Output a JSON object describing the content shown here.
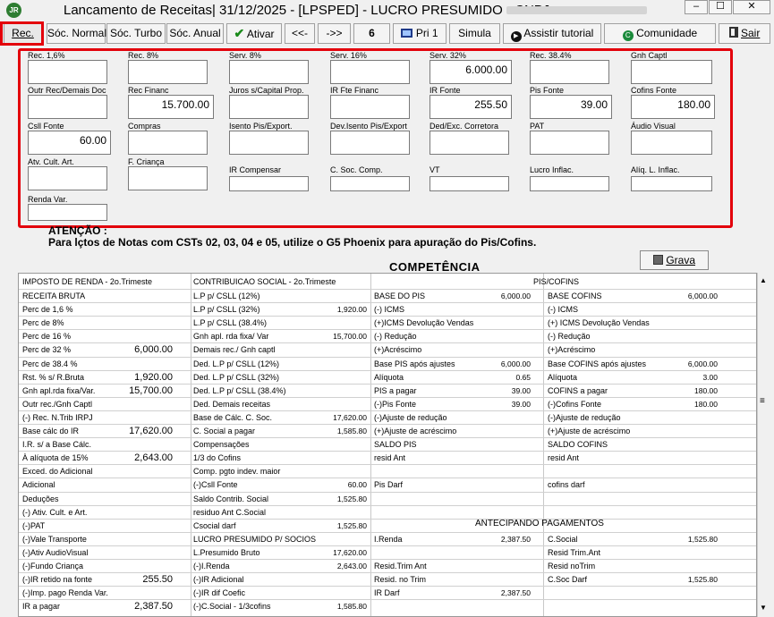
{
  "window": {
    "title": "Lancamento de Receitas|  31/12/2025 - [LPSPED] - LUCRO PRESUMIDO - CNPJ:",
    "min": "–",
    "max": "☐",
    "close": "✕"
  },
  "toolbar": {
    "rec": "Rec.",
    "socio_normal": "Sóc. Normal",
    "socio_turbo": "Sóc. Turbo",
    "socio_anual": "Sóc. Anual",
    "ativar": "Ativar",
    "prev": "<<-",
    "next": "->>",
    "page": "6",
    "pri": "Pri 1",
    "simula": "Simula",
    "tutorial": "Assistir tutorial",
    "comunidade": "Comunidade",
    "sair": "Sair"
  },
  "fields": {
    "rec16": {
      "label": "Rec. 1,6%",
      "value": ""
    },
    "rec8": {
      "label": "Rec. 8%",
      "value": ""
    },
    "serv8": {
      "label": "Serv. 8%",
      "value": ""
    },
    "serv16": {
      "label": "Serv. 16%",
      "value": ""
    },
    "serv32": {
      "label": "Serv. 32%",
      "value": "6.000.00"
    },
    "rec384": {
      "label": "Rec. 38.4%",
      "value": ""
    },
    "gnh_captl": {
      "label": "Gnh Captl",
      "value": ""
    },
    "outr_rec": {
      "label": "Outr Rec/Demais Doc",
      "value": ""
    },
    "rec_financ": {
      "label": "Rec Financ",
      "value": "15.700.00"
    },
    "juros_capital": {
      "label": "Juros s/Capital Prop.",
      "value": ""
    },
    "ir_fte_financ": {
      "label": "IR Fte Financ",
      "value": ""
    },
    "ir_fonte": {
      "label": "IR Fonte",
      "value": "255.50"
    },
    "pis_fonte": {
      "label": "Pis Fonte",
      "value": "39.00"
    },
    "cofins_fonte": {
      "label": "Cofins Fonte",
      "value": "180.00"
    },
    "csll_fonte": {
      "label": "Csll Fonte",
      "value": "60.00"
    },
    "compras": {
      "label": "Compras",
      "value": ""
    },
    "isento_pis": {
      "label": "Isento Pis/Export.",
      "value": ""
    },
    "dev_isento_pis": {
      "label": "Dev.Isento Pis/Export",
      "value": ""
    },
    "ded_exc": {
      "label": "Ded/Exc. Corretora",
      "value": ""
    },
    "pat": {
      "label": "PAT",
      "value": ""
    },
    "audio_visual": {
      "label": "Áudio Visual",
      "value": ""
    },
    "atv_cult": {
      "label": "Atv. Cult. Art.",
      "value": ""
    },
    "f_crianca": {
      "label": "F. Criança",
      "value": ""
    },
    "ir_compensar": {
      "label": "IR Compensar",
      "value": ""
    },
    "c_soc_comp": {
      "label": "C. Soc. Comp.",
      "value": ""
    },
    "vt": {
      "label": "VT",
      "value": ""
    },
    "lucro_inflac": {
      "label": "Lucro Inflac.",
      "value": ""
    },
    "aliq_l_inflac": {
      "label": "Alíq. L. Inflac.",
      "value": ""
    },
    "renda_var": {
      "label": "Renda Var.",
      "value": ""
    }
  },
  "atencao": "ATENÇÃO :",
  "message": "Para lçtos de Notas com CSTs 02, 03, 04 e 05, utilize o G5 Phoenix para apuração do Pis/Cofins.",
  "competencia": "COMPETÊNCIA",
  "grava": "Grava",
  "grid": {
    "h_ir": "IMPOSTO DE RENDA - 2o.Trimeste",
    "h_cs": "CONTRIBUICAO SOCIAL - 2o.Trimeste",
    "h_pc": "PIS/COFINS",
    "ir": [
      [
        "RECEITA BRUTA",
        ""
      ],
      [
        "Perc de 1,6 %",
        ""
      ],
      [
        "Perc de 8%",
        ""
      ],
      [
        "Perc de 16 %",
        ""
      ],
      [
        "Perc de 32 %",
        "6,000.00"
      ],
      [
        "Perc de 38.4 %",
        ""
      ],
      [
        "Rst. % s/ R.Bruta",
        "1,920.00"
      ],
      [
        "Gnh apl.rda fixa/Var.",
        "15,700.00"
      ],
      [
        "Outr rec./Gnh Captl",
        ""
      ],
      [
        "(-) Rec. N.Trib IRPJ",
        ""
      ],
      [
        "Base cálc do IR",
        "17,620.00"
      ],
      [
        "I.R. s/ a Base  Cálc.",
        ""
      ],
      [
        "À alíquota de 15%",
        "2,643.00"
      ],
      [
        "Exced. do Adicional",
        ""
      ],
      [
        "Adicional",
        ""
      ],
      [
        "Deduções",
        ""
      ],
      [
        "(-) Ativ. Cult. e Art.",
        ""
      ],
      [
        "(-)PAT",
        ""
      ],
      [
        "(-)Vale Transporte",
        ""
      ],
      [
        "(-)Ativ AudioVisual",
        ""
      ],
      [
        "(-)Fundo Criança",
        ""
      ],
      [
        "(-)IR retido na fonte",
        "255.50"
      ],
      [
        "(-)Imp. pago Renda Var.",
        ""
      ],
      [
        "IR a pagar",
        "2,387.50"
      ]
    ],
    "cs": [
      [
        "L.P p/ CSLL (12%)",
        ""
      ],
      [
        "L.P p/ CSLL (32%)",
        "1,920.00"
      ],
      [
        "L.P p/ CSLL (38.4%)",
        ""
      ],
      [
        "Gnh apl. rda fixa/ Var",
        "15,700.00"
      ],
      [
        "Demais rec./ Gnh captl",
        ""
      ],
      [
        "Ded. L.P p/ CSLL (12%)",
        ""
      ],
      [
        "Ded. L.P p/ CSLL (32%)",
        ""
      ],
      [
        "Ded. L.P p/ CSLL (38.4%)",
        ""
      ],
      [
        "Ded. Demais receitas",
        ""
      ],
      [
        "Base de Cálc. C. Soc.",
        "17,620.00"
      ],
      [
        "C. Social a pagar",
        "1,585.80"
      ],
      [
        "Compensações",
        ""
      ],
      [
        "1/3 do Cofins",
        ""
      ],
      [
        "Comp. pgto indev. maior",
        ""
      ],
      [
        "(-)Csll Fonte",
        "60.00"
      ],
      [
        "Saldo Contrib. Social",
        "1,525.80"
      ],
      [
        "residuo Ant C.Social",
        ""
      ],
      [
        "Csocial darf",
        "1,525.80"
      ],
      [
        "LUCRO PRESUMIDO  P/  SOCIOS",
        ""
      ],
      [
        "L.Presumido Bruto",
        "17,620.00"
      ],
      [
        "(-)I.Renda",
        "2,643.00"
      ],
      [
        "(-)IR Adicional",
        ""
      ],
      [
        "(-)IR dif Coefic",
        ""
      ],
      [
        "(-)C.Social - 1/3cofins",
        "1,585.80"
      ]
    ],
    "pis": [
      [
        "BASE DO PIS",
        "6,000.00"
      ],
      [
        "(-) ICMS",
        ""
      ],
      [
        "(+)ICMS Devolução Vendas",
        ""
      ],
      [
        "(-) Redução",
        ""
      ],
      [
        "(+)Acréscimo",
        ""
      ],
      [
        "Base PIS após ajustes",
        "6,000.00"
      ],
      [
        "Alíquota",
        "0.65"
      ],
      [
        "PIS a pagar",
        "39.00"
      ],
      [
        "(-)Pis Fonte",
        "39.00"
      ],
      [
        "(-)Ajuste de redução",
        ""
      ],
      [
        "(+)Ajuste de acréscimo",
        ""
      ],
      [
        "SALDO PIS",
        ""
      ],
      [
        "resid Ant",
        ""
      ],
      [
        "",
        ""
      ],
      [
        "Pis Darf",
        ""
      ],
      [
        "",
        ""
      ],
      [
        "",
        ""
      ],
      [
        "",
        ""
      ],
      [
        "I.Renda",
        "2,387.50"
      ],
      [
        "",
        ""
      ],
      [
        "Resid.Trim Ant",
        ""
      ],
      [
        "Resid. no Trim",
        ""
      ],
      [
        "IR Darf",
        "2,387.50"
      ],
      [
        "",
        ""
      ]
    ],
    "cof": [
      [
        "BASE COFINS",
        "6,000.00"
      ],
      [
        "(-) ICMS",
        ""
      ],
      [
        "(+) ICMS Devolução Vendas",
        ""
      ],
      [
        "(-) Redução",
        ""
      ],
      [
        "(+)Acréscimo",
        ""
      ],
      [
        "Base COFINS após ajustes",
        "6,000.00"
      ],
      [
        "Alíquota",
        "3.00"
      ],
      [
        "COFINS a pagar",
        "180.00"
      ],
      [
        "(-)Cofins Fonte",
        "180.00"
      ],
      [
        "(-)Ajuste de redução",
        ""
      ],
      [
        "(+)Ajuste de acréscimo",
        ""
      ],
      [
        "SALDO COFINS",
        ""
      ],
      [
        "resid Ant",
        ""
      ],
      [
        "",
        ""
      ],
      [
        "cofins darf",
        ""
      ],
      [
        "",
        ""
      ],
      [
        "",
        ""
      ],
      [
        "",
        ""
      ],
      [
        "C.Social",
        "1,525.80"
      ],
      [
        "Resid Trim.Ant",
        ""
      ],
      [
        "Resid noTrim",
        ""
      ],
      [
        "C.Soc Darf",
        "1,525.80"
      ],
      [
        "",
        ""
      ],
      [
        "",
        ""
      ]
    ],
    "antecipando": "ANTECIPANDO PAGAMENTOS"
  }
}
